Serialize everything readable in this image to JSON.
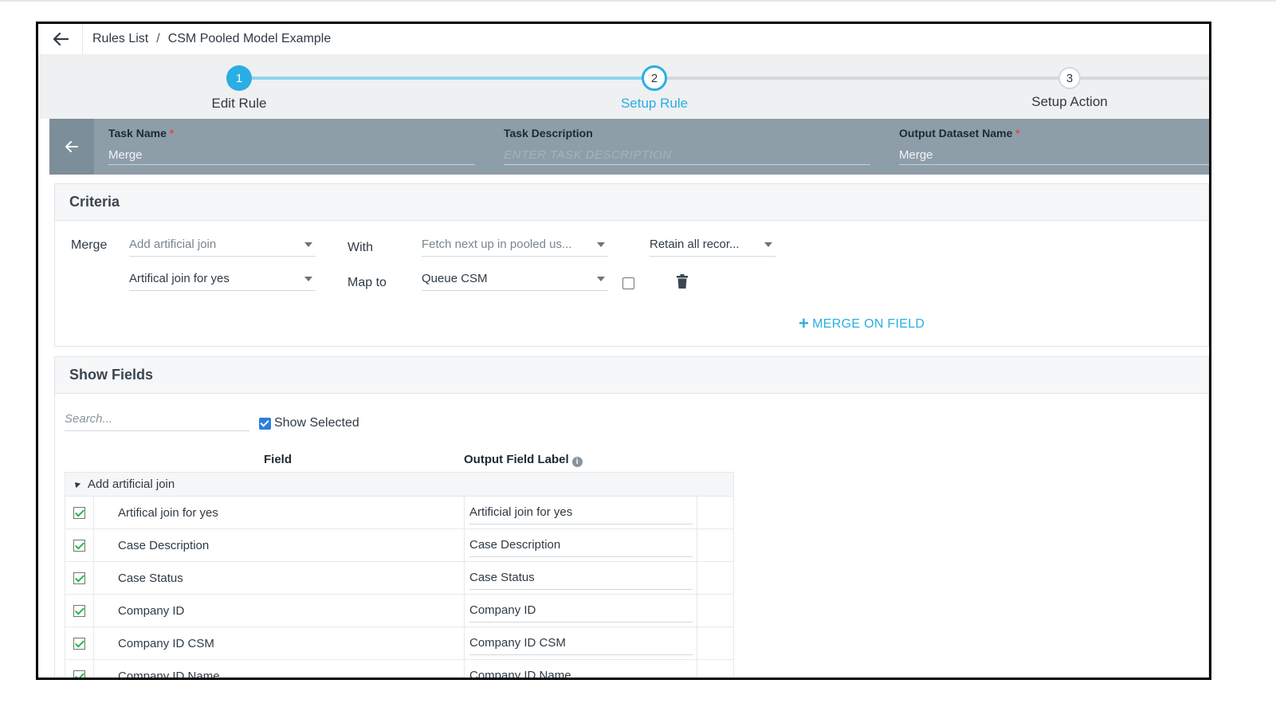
{
  "breadcrumb": {
    "parent": "Rules List",
    "separator": "/",
    "current": "CSM Pooled Model Example"
  },
  "stepper": {
    "steps": [
      {
        "number": "1",
        "label": "Edit Rule",
        "state": "completed"
      },
      {
        "number": "2",
        "label": "Setup Rule",
        "state": "current"
      },
      {
        "number": "3",
        "label": "Setup Action",
        "state": "pending"
      }
    ]
  },
  "task": {
    "name_label": "Task Name",
    "name_value": "Merge",
    "description_label": "Task Description",
    "description_placeholder": "ENTER TASK DESCRIPTION",
    "output_label": "Output Dataset Name",
    "output_value": "Merge",
    "required_mark": "*"
  },
  "criteria": {
    "title": "Criteria",
    "merge_label": "Merge",
    "with_label": "With",
    "map_to_label": "Map to",
    "left_dataset": "Add artificial join",
    "right_dataset": "Fetch next up in pooled us...",
    "join_type": "Retain all recor...",
    "left_field": "Artifical join for yes",
    "right_field": "Queue CSM",
    "add_button": "MERGE ON FIELD",
    "add_icon": "+"
  },
  "show_fields": {
    "title": "Show Fields",
    "search_placeholder": "Search...",
    "show_selected_label": "Show Selected",
    "show_selected_checked": true,
    "col_field": "Field",
    "col_output": "Output Field Label",
    "info_icon": "i",
    "group_name": "Add artificial join",
    "rows": [
      {
        "field": "Artifical join for yes",
        "output": "Artificial join for yes"
      },
      {
        "field": "Case Description",
        "output": "Case Description"
      },
      {
        "field": "Case Status",
        "output": "Case Status"
      },
      {
        "field": "Company ID",
        "output": "Company ID"
      },
      {
        "field": "Company ID CSM",
        "output": "Company ID CSM"
      },
      {
        "field": "Company ID Name",
        "output": "Company ID Name"
      }
    ]
  },
  "colors": {
    "accent": "#2aaee4",
    "task_bar": "#8d9ea9",
    "check_green": "#2bb24c",
    "required": "#e34a4a"
  }
}
